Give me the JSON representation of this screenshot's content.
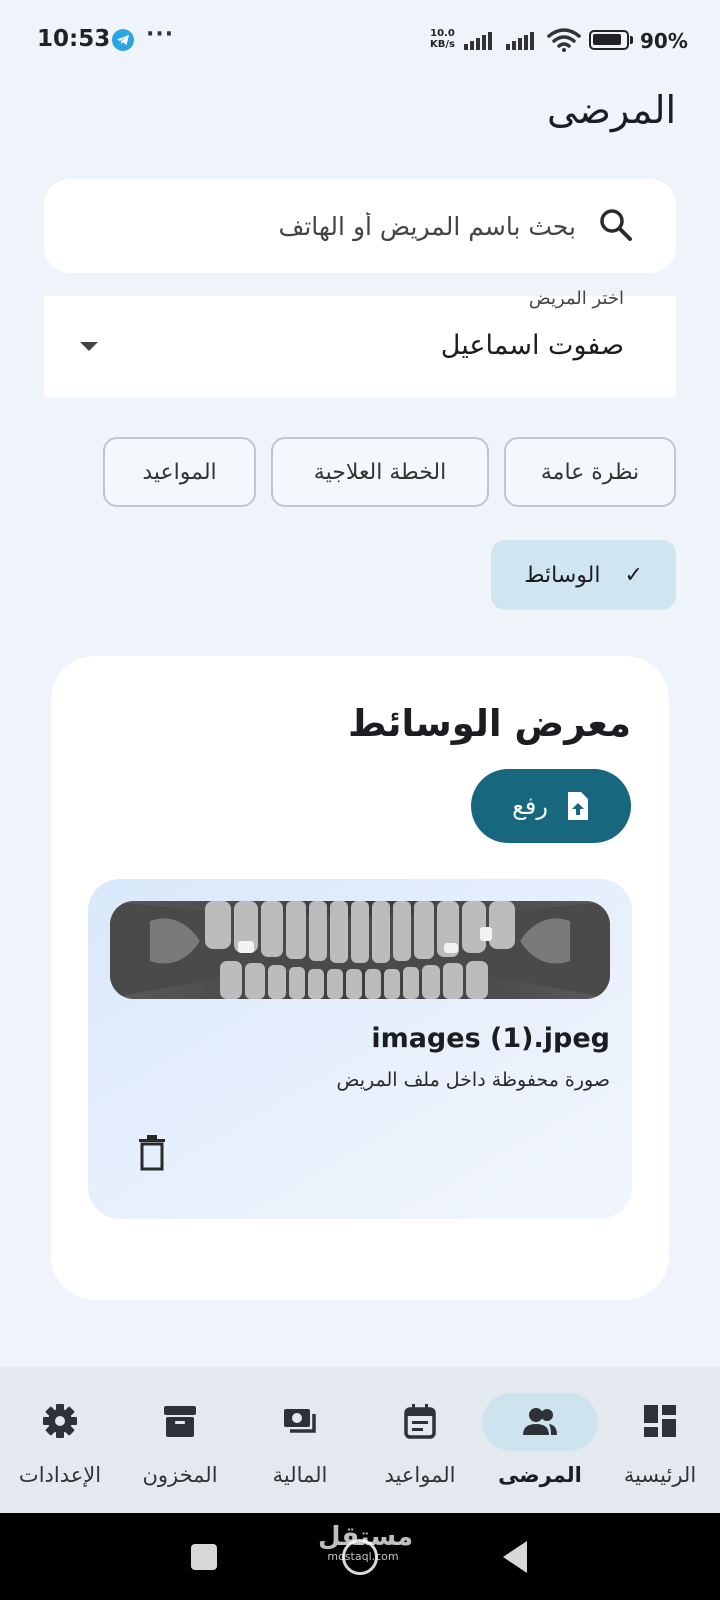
{
  "status_bar": {
    "time": "10:53",
    "dots": "···",
    "net_speed_value": "10.0",
    "net_speed_unit": "KB/s",
    "battery_percent": "90%",
    "battery_level": 0.9,
    "icons": [
      "telegram-icon",
      "signal-icon",
      "wifi-icon",
      "battery-icon"
    ]
  },
  "page": {
    "title": "المرضى"
  },
  "search": {
    "placeholder": "بحث باسم المريض أو الهاتف",
    "icon": "search-icon"
  },
  "patient_select": {
    "label": "اختر المريض",
    "value": "صفوت اسماعيل"
  },
  "tabs": [
    {
      "label": "نظرة عامة",
      "selected": false
    },
    {
      "label": "الخطة العلاجية",
      "selected": false
    },
    {
      "label": "المواعيد",
      "selected": false
    },
    {
      "label": "الوسائط",
      "selected": true,
      "icon": "check-icon"
    }
  ],
  "media_gallery": {
    "title": "معرض الوسائط",
    "upload_label": "رفع",
    "accent_color": "#17677e",
    "items": [
      {
        "file_name": "images (1).jpeg",
        "description": "صورة محفوظة داخل ملف المريض",
        "actions": [
          "delete-icon"
        ]
      }
    ]
  },
  "bottom_nav": {
    "items": [
      {
        "label": "الرئيسية",
        "icon": "dashboard-icon",
        "active": false
      },
      {
        "label": "المرضى",
        "icon": "people-icon",
        "active": true
      },
      {
        "label": "المواعيد",
        "icon": "calendar-icon",
        "active": false
      },
      {
        "label": "المالية",
        "icon": "payments-icon",
        "active": false
      },
      {
        "label": "المخزون",
        "icon": "inventory-icon",
        "active": false
      },
      {
        "label": "الإعدادات",
        "icon": "settings-icon",
        "active": false
      }
    ]
  },
  "watermark": {
    "text_ar": "مستقل",
    "text_en": "mostaql.com"
  }
}
